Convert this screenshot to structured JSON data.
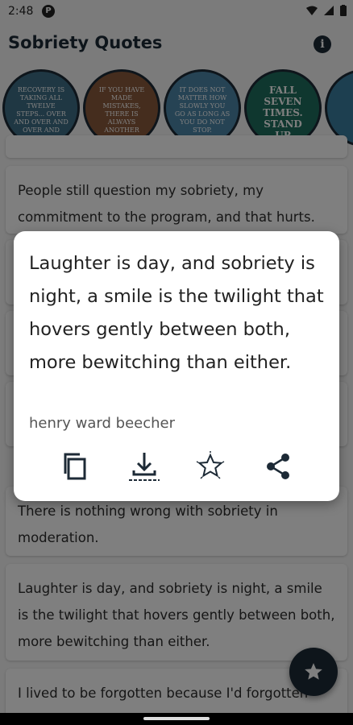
{
  "status_bar": {
    "time": "2:48",
    "badge": "P"
  },
  "app_bar": {
    "title": "Sobriety Quotes",
    "info_label": "i"
  },
  "stories": [
    {
      "text": "RECOVERY IS TAKING ALL TWELVE STEPS... OVER AND OVER AND OVER AND OVER...",
      "color": "#3f6e86"
    },
    {
      "text": "IF YOU HAVE MADE MISTAKES, THERE IS ALWAYS ANOTHER CHANCE FOR YOU.",
      "color": "#8a5a3c"
    },
    {
      "text": "IT DOES NOT MATTER HOW SLOWLY YOU GO AS LONG AS YOU DO NOT STOP.",
      "color": "#4d86a8"
    },
    {
      "text": "FALL SEVEN TIMES. STAND UP EIGHT.",
      "color": "#1f6f5e"
    },
    {
      "text": "",
      "color": "#3b7ea0"
    }
  ],
  "quote_list": [
    {
      "text": "People still question my sobriety, my commitment to the program, and that hurts."
    },
    {
      "text": "There is nothing wrong with sobriety in moderation."
    },
    {
      "text": "Laughter is day, and sobriety is night, a smile is the twilight that hovers gently between both, more bewitching than either."
    },
    {
      "text": "I lived to be forgotten because I'd forgotten"
    }
  ],
  "dialog": {
    "quote": "Laughter is day, and sobriety is night, a smile is the twilight that hovers gently between both, more bewitching than either.",
    "author": "henry ward beecher",
    "actions": [
      "copy-icon",
      "download-icon",
      "favorite-star-icon",
      "share-icon"
    ]
  },
  "colors": {
    "primary": "#1d2a36",
    "scrim": "rgba(0,0,0,0.5)",
    "background": "#f7f7f7"
  }
}
